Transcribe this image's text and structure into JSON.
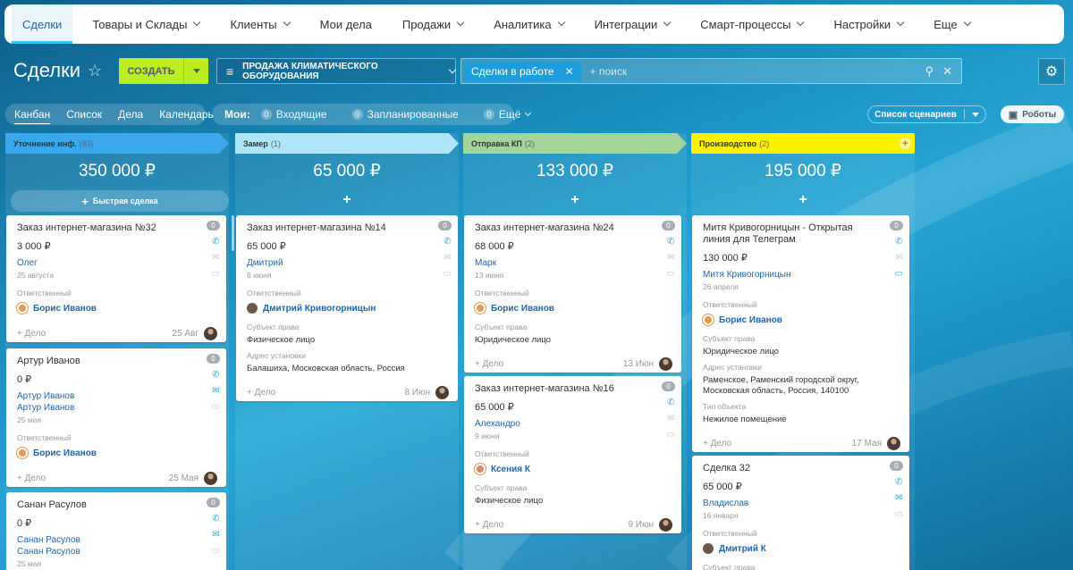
{
  "nav": {
    "items": [
      {
        "label": "Сделки",
        "active": true,
        "dropdown": false
      },
      {
        "label": "Товары и Склады",
        "dropdown": true
      },
      {
        "label": "Клиенты",
        "dropdown": true
      },
      {
        "label": "Мои дела",
        "dropdown": false
      },
      {
        "label": "Продажи",
        "dropdown": true
      },
      {
        "label": "Аналитика",
        "dropdown": true
      },
      {
        "label": "Интеграции",
        "dropdown": true
      },
      {
        "label": "Смарт-процессы",
        "dropdown": true
      },
      {
        "label": "Настройки",
        "dropdown": true
      },
      {
        "label": "Еще",
        "dropdown": true
      }
    ]
  },
  "header": {
    "title": "Сделки",
    "create_label": "СОЗДАТЬ",
    "pipeline": "ПРОДАЖА КЛИМАТИЧЕСКОГО ОБОРУДОВАНИЯ",
    "filter_chip": "Сделки в работе",
    "search_placeholder": "+ поиск"
  },
  "views": {
    "items": [
      "Канбан",
      "Список",
      "Дела",
      "Календарь"
    ]
  },
  "mine": {
    "label": "Мои:",
    "items": [
      {
        "count": "0",
        "label": "Входящие"
      },
      {
        "count": "0",
        "label": "Запланированные"
      },
      {
        "count": "0",
        "label": "Ещё"
      }
    ]
  },
  "toolbar": {
    "scenarios": "Список сценариев",
    "robots": "Роботы"
  },
  "columns": [
    {
      "name": "Уточнение инф.",
      "count": "(93)",
      "sum": "350 000 ₽",
      "color": "#39a8ef",
      "quick": "Быстрая сделка",
      "cards": [
        {
          "title": "Заказ интернет-магазина №32",
          "amount": "3 000 ₽",
          "contacts": [
            "Олег"
          ],
          "date": "25 августа",
          "resp_label": "Ответственный",
          "resp": "Борис Иванов",
          "fields": [],
          "add": "+ Дело",
          "due": "25 Авг",
          "badge": "0"
        },
        {
          "title": "Артур Иванов",
          "amount": "0 ₽",
          "contacts": [
            "Артур Иванов",
            "Артур Иванов"
          ],
          "date": "25 мая",
          "resp_label": "Ответственный",
          "resp": "Борис Иванов",
          "fields": [],
          "add": "+ Дело",
          "due": "25 Мая",
          "badge": "0"
        },
        {
          "title": "Санан Расулов",
          "amount": "0 ₽",
          "contacts": [
            "Санан Расулов",
            "Санан Расулов"
          ],
          "date": "25 мая",
          "resp_label": "",
          "resp": "",
          "fields": [],
          "add": "",
          "due": "",
          "badge": "0"
        }
      ]
    },
    {
      "name": "Замер",
      "count": "(1)",
      "sum": "65 000 ₽",
      "color": "#aee5f8",
      "quick": "+",
      "cards": [
        {
          "title": "Заказ интернет-магазина №14",
          "amount": "65 000 ₽",
          "contacts": [
            "Дмитрий"
          ],
          "date": "8 июня",
          "resp_label": "Ответственный",
          "resp": "Дмитрий Кривогорницын",
          "fields": [
            {
              "label": "Субъект права",
              "value": "Физическое лицо"
            },
            {
              "label": "Адрес установки",
              "value": "Балашиха, Московская область, Россия"
            }
          ],
          "add": "+ Дело",
          "due": "8 Июн",
          "badge": "0"
        }
      ]
    },
    {
      "name": "Отправка КП",
      "count": "(2)",
      "sum": "133 000 ₽",
      "color": "#a3d49a",
      "quick": "+",
      "cards": [
        {
          "title": "Заказ интернет-магазина №24",
          "amount": "68 000 ₽",
          "contacts": [
            "Марк"
          ],
          "date": "13 июня",
          "resp_label": "Ответственный",
          "resp": "Борис Иванов",
          "fields": [
            {
              "label": "Субъект права",
              "value": "Юридическое лицо"
            }
          ],
          "add": "+ Дело",
          "due": "13 Июн",
          "badge": "0"
        },
        {
          "title": "Заказ интернет-магазина №16",
          "amount": "65 000 ₽",
          "contacts": [
            "Алехандро"
          ],
          "date": "9 июня",
          "resp_label": "Ответственный",
          "resp": "Ксения К",
          "fields": [
            {
              "label": "Субъект права",
              "value": "Физическое лицо"
            }
          ],
          "add": "+ Дело",
          "due": "9 Июн",
          "badge": "0"
        }
      ]
    },
    {
      "name": "Производство",
      "count": "(2)",
      "sum": "195 000 ₽",
      "color": "#fff200",
      "quick": "+",
      "cards": [
        {
          "title": "Митя Кривогорницын - Открытая линия для Телеграм",
          "amount": "130 000 ₽",
          "contacts": [
            "Митя Кривогорницын"
          ],
          "date": "26 апреля",
          "resp_label": "Ответственный",
          "resp": "Борис Иванов",
          "fields": [
            {
              "label": "Субъект права",
              "value": "Юридическое лицо"
            },
            {
              "label": "Адрес установки",
              "value": "Раменское, Раменский городской округ, Московская область, Россия, 140100"
            },
            {
              "label": "Тип объекта",
              "value": "Нежилое помещение"
            }
          ],
          "add": "+ Дело",
          "due": "17 Мая",
          "badge": "0"
        },
        {
          "title": "Сделка 32",
          "amount": "65 000 ₽",
          "contacts": [
            "Владислав"
          ],
          "date": "16 января",
          "resp_label": "Ответственный",
          "resp": "Дмитрий К",
          "fields": [
            {
              "label": "Субъект права",
              "value": ""
            }
          ],
          "add": "",
          "due": "",
          "badge": "0"
        }
      ]
    }
  ]
}
